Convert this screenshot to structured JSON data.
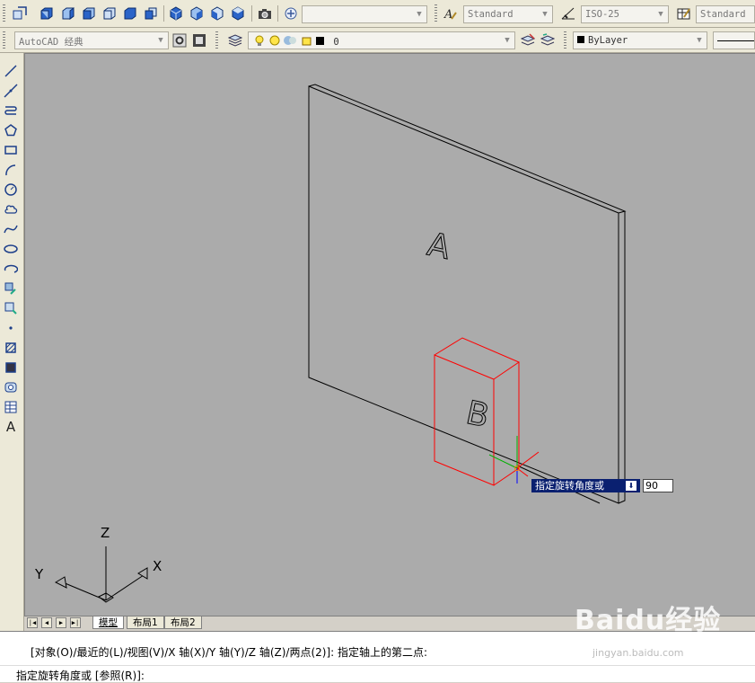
{
  "toolbar_row1": {
    "dropdown_blank": "",
    "text_style": "Standard",
    "dim_style": "ISO-25",
    "table_style": "Standard"
  },
  "toolbar_row2": {
    "workspace": "AutoCAD 经典",
    "layer_name": "0",
    "color": "ByLayer"
  },
  "drawing": {
    "label_a": "A",
    "label_b": "B",
    "ucs_x": "X",
    "ucs_y": "Y",
    "ucs_z": "Z"
  },
  "dynamic_input": {
    "prompt": "指定旋转角度或",
    "value": "90"
  },
  "tabs": [
    {
      "label": "模型",
      "active": true
    },
    {
      "label": "布局1",
      "active": false
    },
    {
      "label": "布局2",
      "active": false
    }
  ],
  "command": {
    "history": "[对象(O)/最近的(L)/视图(V)/X 轴(X)/Y 轴(Y)/Z 轴(Z)/两点(2)]: 指定轴上的第二点:",
    "current": "指定旋转角度或 [参照(R)]:"
  },
  "watermark": {
    "brand": "Baidu经验",
    "url": "jingyan.baidu.com"
  },
  "colors": {
    "canvas": "#ababab",
    "selected_object": "#ff0000",
    "prompt_bg": "#0a2070"
  }
}
